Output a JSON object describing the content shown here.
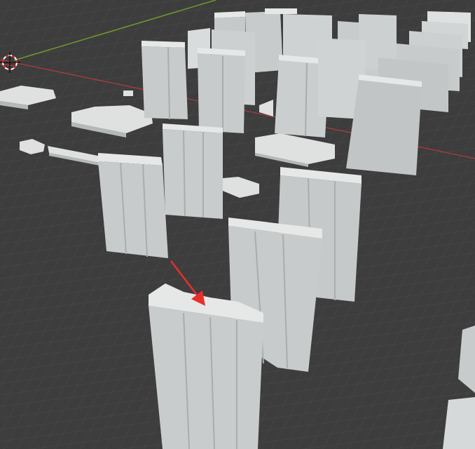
{
  "app": {
    "view": "3d-viewport"
  },
  "scene": {
    "background_color": "#3d3d3d",
    "grid_color": "#4b4b4b",
    "x_axis_color": "#b83b3b",
    "y_axis_color": "#6f9a2c",
    "building_top_color": "#e6e8e8",
    "building_light_color": "#c8cbcb",
    "building_dark_color": "#a7abab",
    "annotation_arrow_color": "#e8302a"
  },
  "objects": {
    "cursor": {
      "icon": "3d-cursor-icon"
    },
    "buildings_count_visible": 40,
    "annotation": {
      "icon": "red-arrow-icon"
    }
  }
}
